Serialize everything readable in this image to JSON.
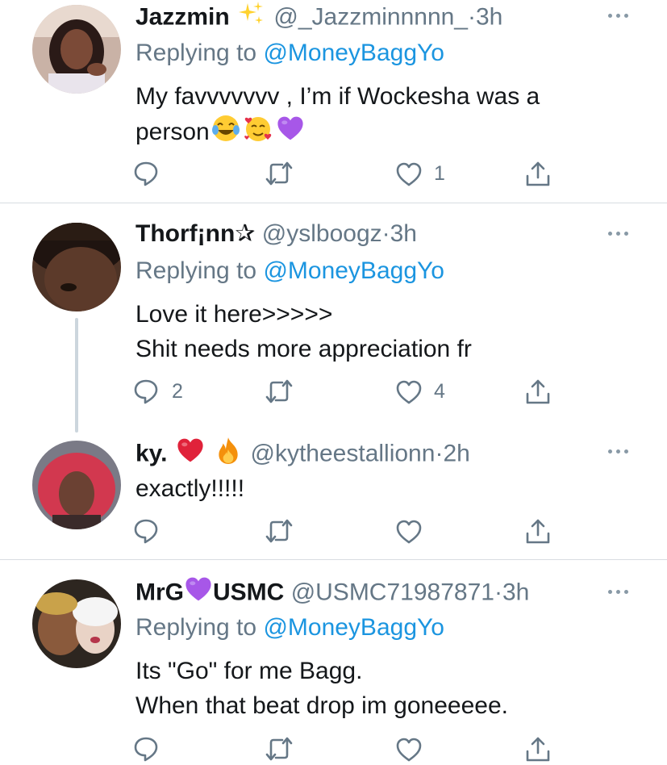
{
  "tweets": [
    {
      "name": "Jazzmin",
      "name_emoji": "sparkles-icon",
      "handle": "@_Jazzminnnnn_",
      "dot": "·",
      "time": "3h",
      "replying_prefix": "Replying to",
      "replying_to": "@MoneyBaggYo",
      "text_lines": [
        "My favvvvvvv , I’m if Wockesha was a",
        "person"
      ],
      "text_emojis": [
        "joy-icon",
        "smiling-face-hearts-icon",
        "purple-heart-icon"
      ],
      "counts": {
        "reply": "",
        "retweet": "",
        "like": "1"
      }
    },
    {
      "name": "Thorf¡nn✰",
      "handle": "@yslboogz",
      "dot": "·",
      "time": "3h",
      "replying_prefix": "Replying to",
      "replying_to": "@MoneyBaggYo",
      "text_lines": [
        "Love it here>>>>>",
        "Shit needs more appreciation fr"
      ],
      "counts": {
        "reply": "2",
        "retweet": "",
        "like": "4"
      }
    },
    {
      "name": "ky.",
      "name_emojis": [
        "red-heart-icon",
        "fire-icon"
      ],
      "handle": "@kytheestallionn",
      "dot": "·",
      "time": "2h",
      "text_lines": [
        "exactly!!!!!"
      ],
      "counts": {
        "reply": "",
        "retweet": "",
        "like": ""
      }
    },
    {
      "name_part1": "MrG",
      "name_emoji": "purple-heart-icon",
      "name_part2": "USMC",
      "handle": "@USMC71987871",
      "dot": "·",
      "time": "3h",
      "replying_prefix": "Replying to",
      "replying_to": "@MoneyBaggYo",
      "text_lines": [
        "Its \"Go\" for me Bagg.",
        "When that beat drop im goneeeee."
      ],
      "counts": {
        "reply": "",
        "retweet": "",
        "like": ""
      }
    }
  ],
  "colors": {
    "text": "#14171a",
    "secondary": "#657786",
    "link": "#1b95e0",
    "divider": "#d8dde1",
    "thread": "#ccd6dd"
  }
}
